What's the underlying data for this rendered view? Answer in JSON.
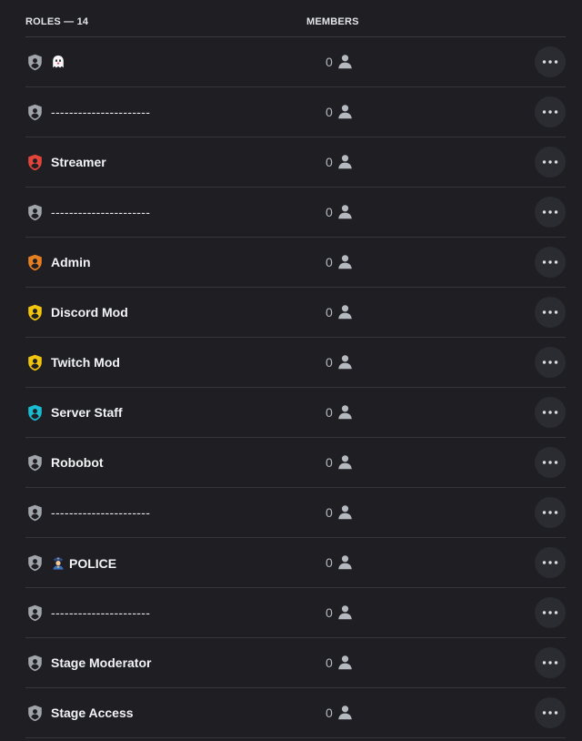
{
  "header": {
    "roles_label": "ROLES — 14",
    "members_label": "MEMBERS"
  },
  "roles": [
    {
      "name": "",
      "emoji": "ghost",
      "color": "#a0a4ab",
      "members": "0",
      "dashes": false
    },
    {
      "name": "----------------------",
      "emoji": "",
      "color": "#a0a4ab",
      "members": "0",
      "dashes": true
    },
    {
      "name": "Streamer",
      "emoji": "",
      "color": "#e4453a",
      "members": "0",
      "dashes": false
    },
    {
      "name": "----------------------",
      "emoji": "",
      "color": "#a0a4ab",
      "members": "0",
      "dashes": true
    },
    {
      "name": "Admin",
      "emoji": "",
      "color": "#e67e22",
      "members": "0",
      "dashes": false
    },
    {
      "name": "Discord Mod",
      "emoji": "",
      "color": "#f1c40f",
      "members": "0",
      "dashes": false
    },
    {
      "name": "Twitch Mod",
      "emoji": "",
      "color": "#f1c40f",
      "members": "0",
      "dashes": false
    },
    {
      "name": "Server Staff",
      "emoji": "",
      "color": "#1abcd4",
      "members": "0",
      "dashes": false
    },
    {
      "name": "Robobot",
      "emoji": "",
      "color": "#a0a4ab",
      "members": "0",
      "dashes": false
    },
    {
      "name": "----------------------",
      "emoji": "",
      "color": "#a0a4ab",
      "members": "0",
      "dashes": true
    },
    {
      "name": "POLICE",
      "emoji": "police-officer",
      "color": "#a0a4ab",
      "members": "0",
      "dashes": false
    },
    {
      "name": "----------------------",
      "emoji": "",
      "color": "#a0a4ab",
      "members": "0",
      "dashes": true
    },
    {
      "name": "Stage Moderator",
      "emoji": "",
      "color": "#a0a4ab",
      "members": "0",
      "dashes": false
    },
    {
      "name": "Stage Access",
      "emoji": "",
      "color": "#a0a4ab",
      "members": "0",
      "dashes": false
    }
  ],
  "icons": {
    "role": "shield-icon",
    "member": "person-icon",
    "more": "more-options-icon"
  }
}
